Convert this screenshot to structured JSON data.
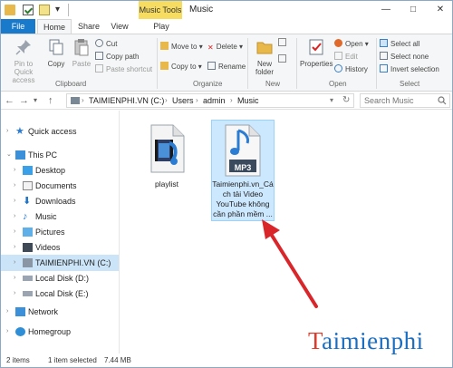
{
  "window": {
    "title": "Music",
    "context_tab": "Music Tools",
    "controls": {
      "minimize": "—",
      "maximize": "□",
      "close": "✕"
    }
  },
  "quick_access_toolbar": {
    "chevron": "▾"
  },
  "ribbon_tabs": [
    {
      "label": "File"
    },
    {
      "label": "Home"
    },
    {
      "label": "Share"
    },
    {
      "label": "View"
    },
    {
      "label": "Play"
    }
  ],
  "ribbon": {
    "clipboard": {
      "label": "Clipboard",
      "pin": "Pin to Quick access",
      "copy": "Copy",
      "paste": "Paste",
      "cut": "Cut",
      "copy_path": "Copy path",
      "paste_shortcut": "Paste shortcut"
    },
    "organize": {
      "label": "Organize",
      "move_to": "Move to",
      "copy_to": "Copy to",
      "delete": "Delete",
      "rename": "Rename"
    },
    "new": {
      "label": "New",
      "new_folder": "New folder"
    },
    "open": {
      "label": "Open",
      "properties": "Properties",
      "open": "Open",
      "edit": "Edit",
      "history": "History"
    },
    "select": {
      "label": "Select",
      "select_all": "Select all",
      "select_none": "Select none",
      "invert": "Invert selection"
    }
  },
  "address": {
    "crumbs": [
      "TAIMIENPHI.VN (C:)",
      "Users",
      "admin",
      "Music"
    ],
    "search_placeholder": "Search Music"
  },
  "sidebar": {
    "items": [
      {
        "label": "Quick access"
      },
      {
        "label": "This PC"
      },
      {
        "label": "Desktop"
      },
      {
        "label": "Documents"
      },
      {
        "label": "Downloads"
      },
      {
        "label": "Music"
      },
      {
        "label": "Pictures"
      },
      {
        "label": "Videos"
      },
      {
        "label": "TAIMIENPHI.VN (C:)"
      },
      {
        "label": "Local Disk (D:)"
      },
      {
        "label": "Local Disk (E:)"
      },
      {
        "label": "Network"
      },
      {
        "label": "Homegroup"
      }
    ]
  },
  "files": [
    {
      "name": "playlist"
    },
    {
      "name_lines": [
        "Taimienphi.vn_Cá",
        "ch tải Video",
        "YouTube không",
        "cần phần mềm ..."
      ],
      "badge": "MP3"
    }
  ],
  "status": {
    "count": "2 items",
    "selected": "1 item selected",
    "size": "7.44 MB"
  },
  "watermark": {
    "first": "T",
    "rest": "aimienphi"
  },
  "colors": {
    "file_tab": "#1979ca",
    "context_tab": "#f6dd62",
    "selection": "#cce8ff",
    "arrow": "#d9262b",
    "watermark": "#1a6ec2"
  }
}
